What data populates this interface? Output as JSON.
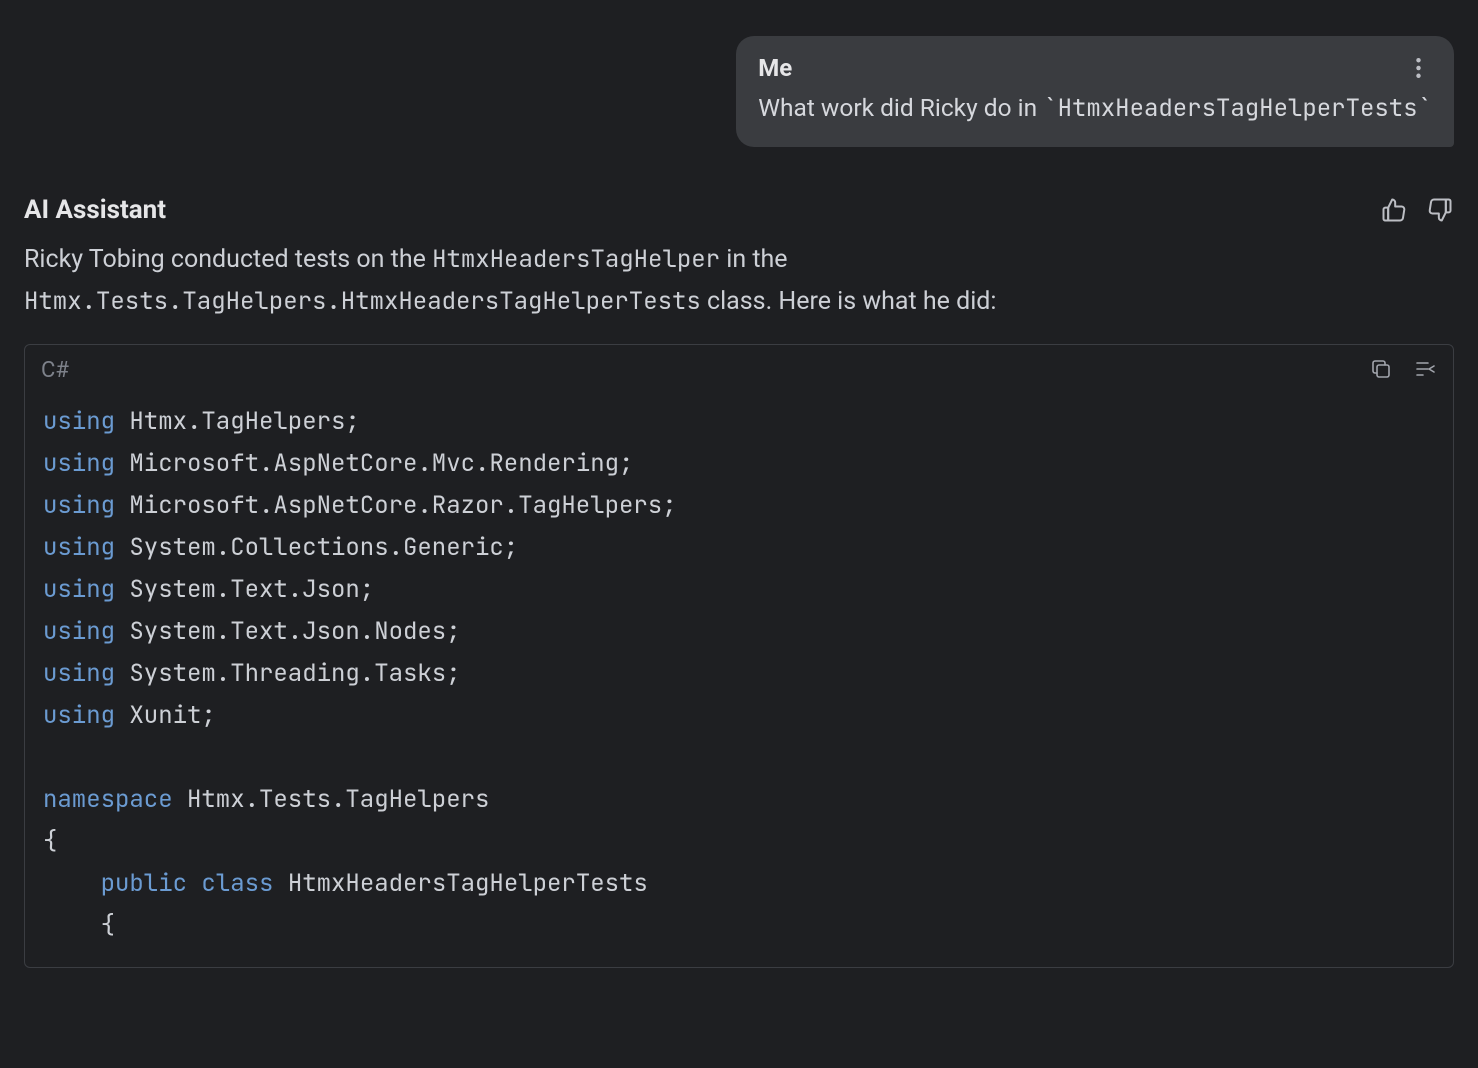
{
  "user": {
    "name": "Me",
    "text_prefix": "What work did Ricky do in ",
    "text_code": "`HtmxHeadersTagHelperTests`"
  },
  "assistant": {
    "label": "AI Assistant",
    "line1_prefix": "Ricky Tobing conducted tests on the ",
    "line1_code": "HtmxHeadersTagHelper",
    "line1_suffix": " in the ",
    "line2_code": "Htmx.Tests.TagHelpers.HtmxHeadersTagHelperTests",
    "line2_suffix": " class. Here is what he did:"
  },
  "code": {
    "language": "C#",
    "kw_using": "using",
    "kw_namespace": "namespace",
    "kw_public": "public",
    "kw_class": "class",
    "ns1": " Htmx.TagHelpers;",
    "ns2": " Microsoft.AspNetCore.Mvc.Rendering;",
    "ns3": " Microsoft.AspNetCore.Razor.TagHelpers;",
    "ns4": " System.Collections.Generic;",
    "ns5": " System.Text.Json;",
    "ns6": " System.Text.Json.Nodes;",
    "ns7": " System.Threading.Tasks;",
    "ns8": " Xunit;",
    "ns_decl": " Htmx.Tests.TagHelpers",
    "brace_open": "{",
    "indent_brace_open": "    {",
    "class_decl_prefix": "    ",
    "class_name": " HtmxHeadersTagHelperTests"
  }
}
